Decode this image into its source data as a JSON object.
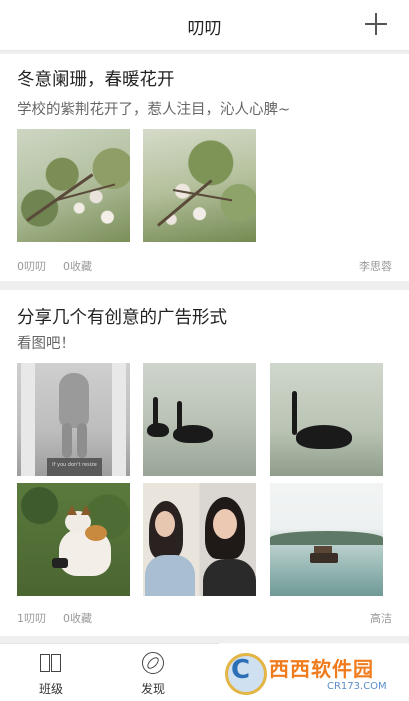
{
  "header": {
    "title": "叨叨"
  },
  "posts": [
    {
      "title": "冬意阑珊，春暖花开",
      "subtitle": "学校的紫荆花开了，惹人注目，沁人心脾~",
      "likes": "0叨叨",
      "favorites": "0收藏",
      "author": "李思蓉"
    },
    {
      "title": "分享几个有创意的广告形式",
      "subtitle": "看图吧！",
      "likes": "1叨叨",
      "favorites": "0收藏",
      "author": "高洁"
    }
  ],
  "tabs": [
    {
      "label": "班级",
      "icon": "book-columns-icon"
    },
    {
      "label": "发现",
      "icon": "compass-icon"
    },
    {
      "label": "",
      "icon": ""
    },
    {
      "label": "",
      "icon": ""
    }
  ],
  "watermark": {
    "brand": "西西软件园",
    "url": "CR173.COM"
  },
  "photo_caption": "If you don't resize"
}
